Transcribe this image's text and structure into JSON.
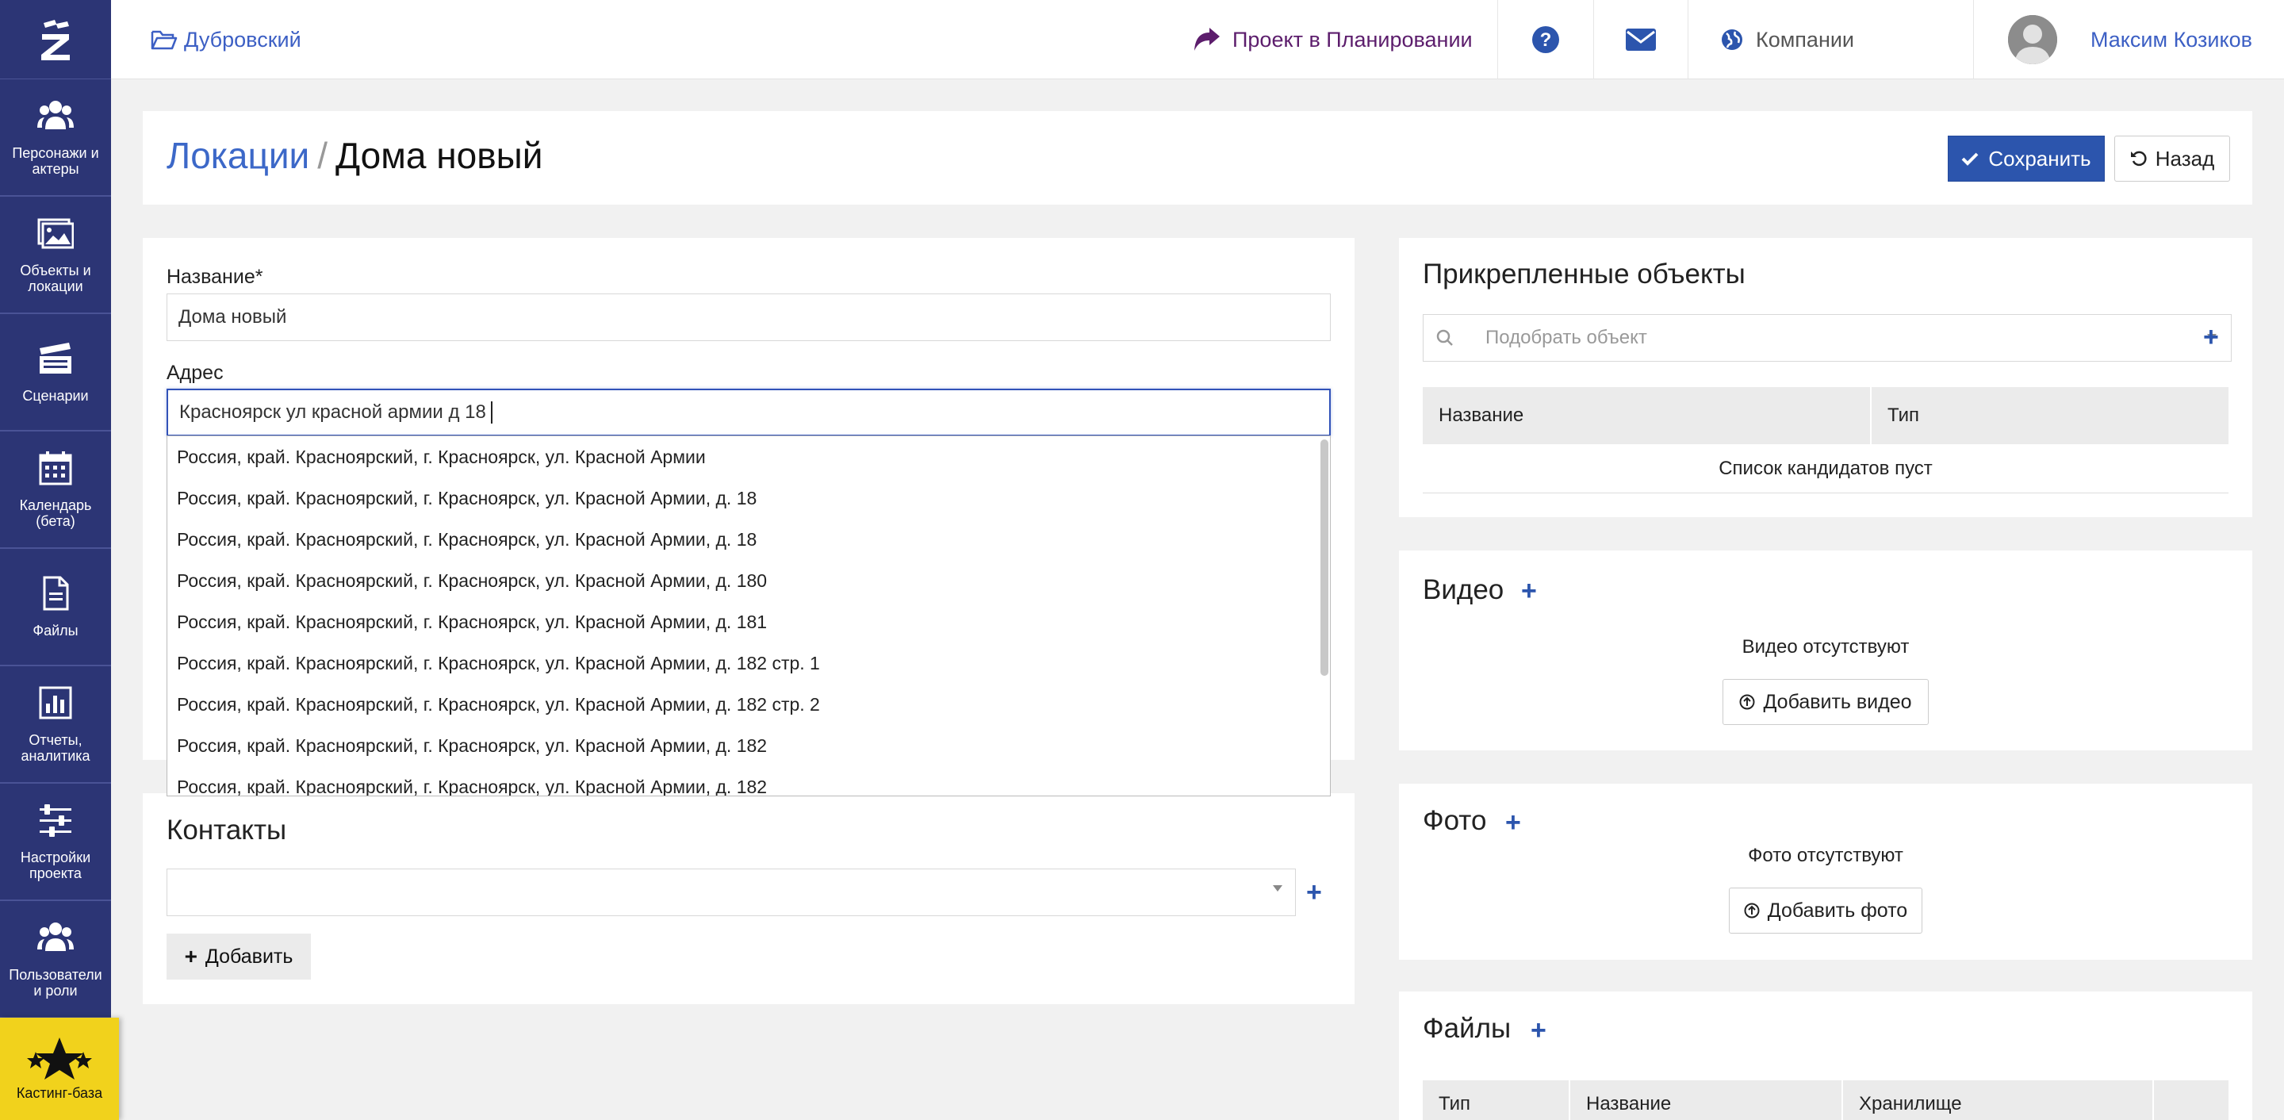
{
  "sidebar": {
    "items": [
      {
        "label": "Персонажи и актеры",
        "icon": "users-icon"
      },
      {
        "label": "Объекты и локации",
        "icon": "image-icon"
      },
      {
        "label": "Сценарии",
        "icon": "clapperboard-icon"
      },
      {
        "label": "Календарь (бета)",
        "icon": "calendar-icon"
      },
      {
        "label": "Файлы",
        "icon": "file-icon"
      },
      {
        "label": "Отчеты, аналитика",
        "icon": "chart-icon"
      },
      {
        "label": "Настройки проекта",
        "icon": "sliders-icon"
      },
      {
        "label": "Пользователи и роли",
        "icon": "users-icon"
      }
    ],
    "casting": {
      "label": "Кастинг-база",
      "icon": "stars-icon"
    }
  },
  "topbar": {
    "project": "Дубровский",
    "status": "Проект в Планировании",
    "companies": "Компании",
    "user_name": "Максим Козиков"
  },
  "header": {
    "crumb_parent": "Локации",
    "crumb_sep": "/",
    "crumb_current": "Дома новый",
    "save_label": "Сохранить",
    "back_label": "Назад"
  },
  "form": {
    "name_label": "Название",
    "name_required": "*",
    "name_value": "Дома новый",
    "address_label": "Адрес",
    "address_value": "Красноярск ул красной армии д 18",
    "suggestions": [
      "Россия, край. Красноярский, г. Красноярск, ул. Красной Армии",
      "Россия, край. Красноярский, г. Красноярск, ул. Красной Армии, д. 18",
      "Россия, край. Красноярский, г. Красноярск, ул. Красной Армии, д. 18",
      "Россия, край. Красноярский, г. Красноярск, ул. Красной Армии, д. 180",
      "Россия, край. Красноярский, г. Красноярск, ул. Красной Армии, д. 181",
      "Россия, край. Красноярский, г. Красноярск, ул. Красной Армии, д. 182 стр. 1",
      "Россия, край. Красноярский, г. Красноярск, ул. Красной Армии, д. 182 стр. 2",
      "Россия, край. Красноярский, г. Красноярск, ул. Красной Армии, д. 182",
      "Россия, край. Красноярский, г. Красноярск, ул. Красной Армии, д. 182"
    ]
  },
  "contacts": {
    "title": "Контакты",
    "add_label": "Добавить"
  },
  "attached": {
    "title": "Прикрепленные объекты",
    "placeholder": "Подобрать объект",
    "col_name": "Название",
    "col_type": "Тип",
    "empty": "Список кандидатов пуст"
  },
  "video": {
    "title": "Видео",
    "empty": "Видео отсутствуют",
    "add_label": "Добавить видео"
  },
  "photo": {
    "title": "Фото",
    "empty": "Фото отсутствуют",
    "add_label": "Добавить фото"
  },
  "files": {
    "title": "Файлы",
    "col_type": "Тип",
    "col_name": "Название",
    "col_storage": "Хранилище"
  },
  "colors": {
    "sidebar": "#2c3575",
    "accent": "#2c55ad",
    "link": "#3c68c8",
    "casting": "#f1d21c",
    "status": "#5c1d6c"
  }
}
